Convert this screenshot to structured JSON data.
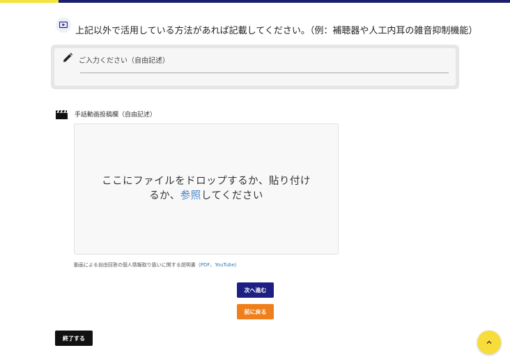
{
  "question": {
    "icon": "video-play-icon",
    "text": "上記以外で活用している方法があれば記載してください。（例：補聴器や人工内耳の雑音抑制機能）"
  },
  "free_input": {
    "icon": "pencil-icon",
    "placeholder": "ご入力ください（自由記述）",
    "value": ""
  },
  "video_upload": {
    "icon": "clapperboard-icon",
    "label": "手話動画投稿欄（自由記述）",
    "dropzone_text": "ここにファイルをドロップするか、貼り付けるか、",
    "dropzone_link": "参照",
    "dropzone_suffix": "してください"
  },
  "privacy_note": {
    "text": "動画による自由回答の個人情報取り扱いに関する説明書（",
    "link_pdf": "PDF",
    "separator": "、",
    "link_youtube": "YouTube",
    "close": "）"
  },
  "buttons": {
    "next": "次へ進む",
    "prev": "前に戻る",
    "end": "終了する"
  },
  "scroll_top": {
    "icon": "chevron-up-icon"
  },
  "colors": {
    "brand_navy": "#1d2082",
    "accent_yellow": "#f5e33b",
    "prev_orange": "#ef7f1a",
    "link_blue": "#4a86c7"
  }
}
